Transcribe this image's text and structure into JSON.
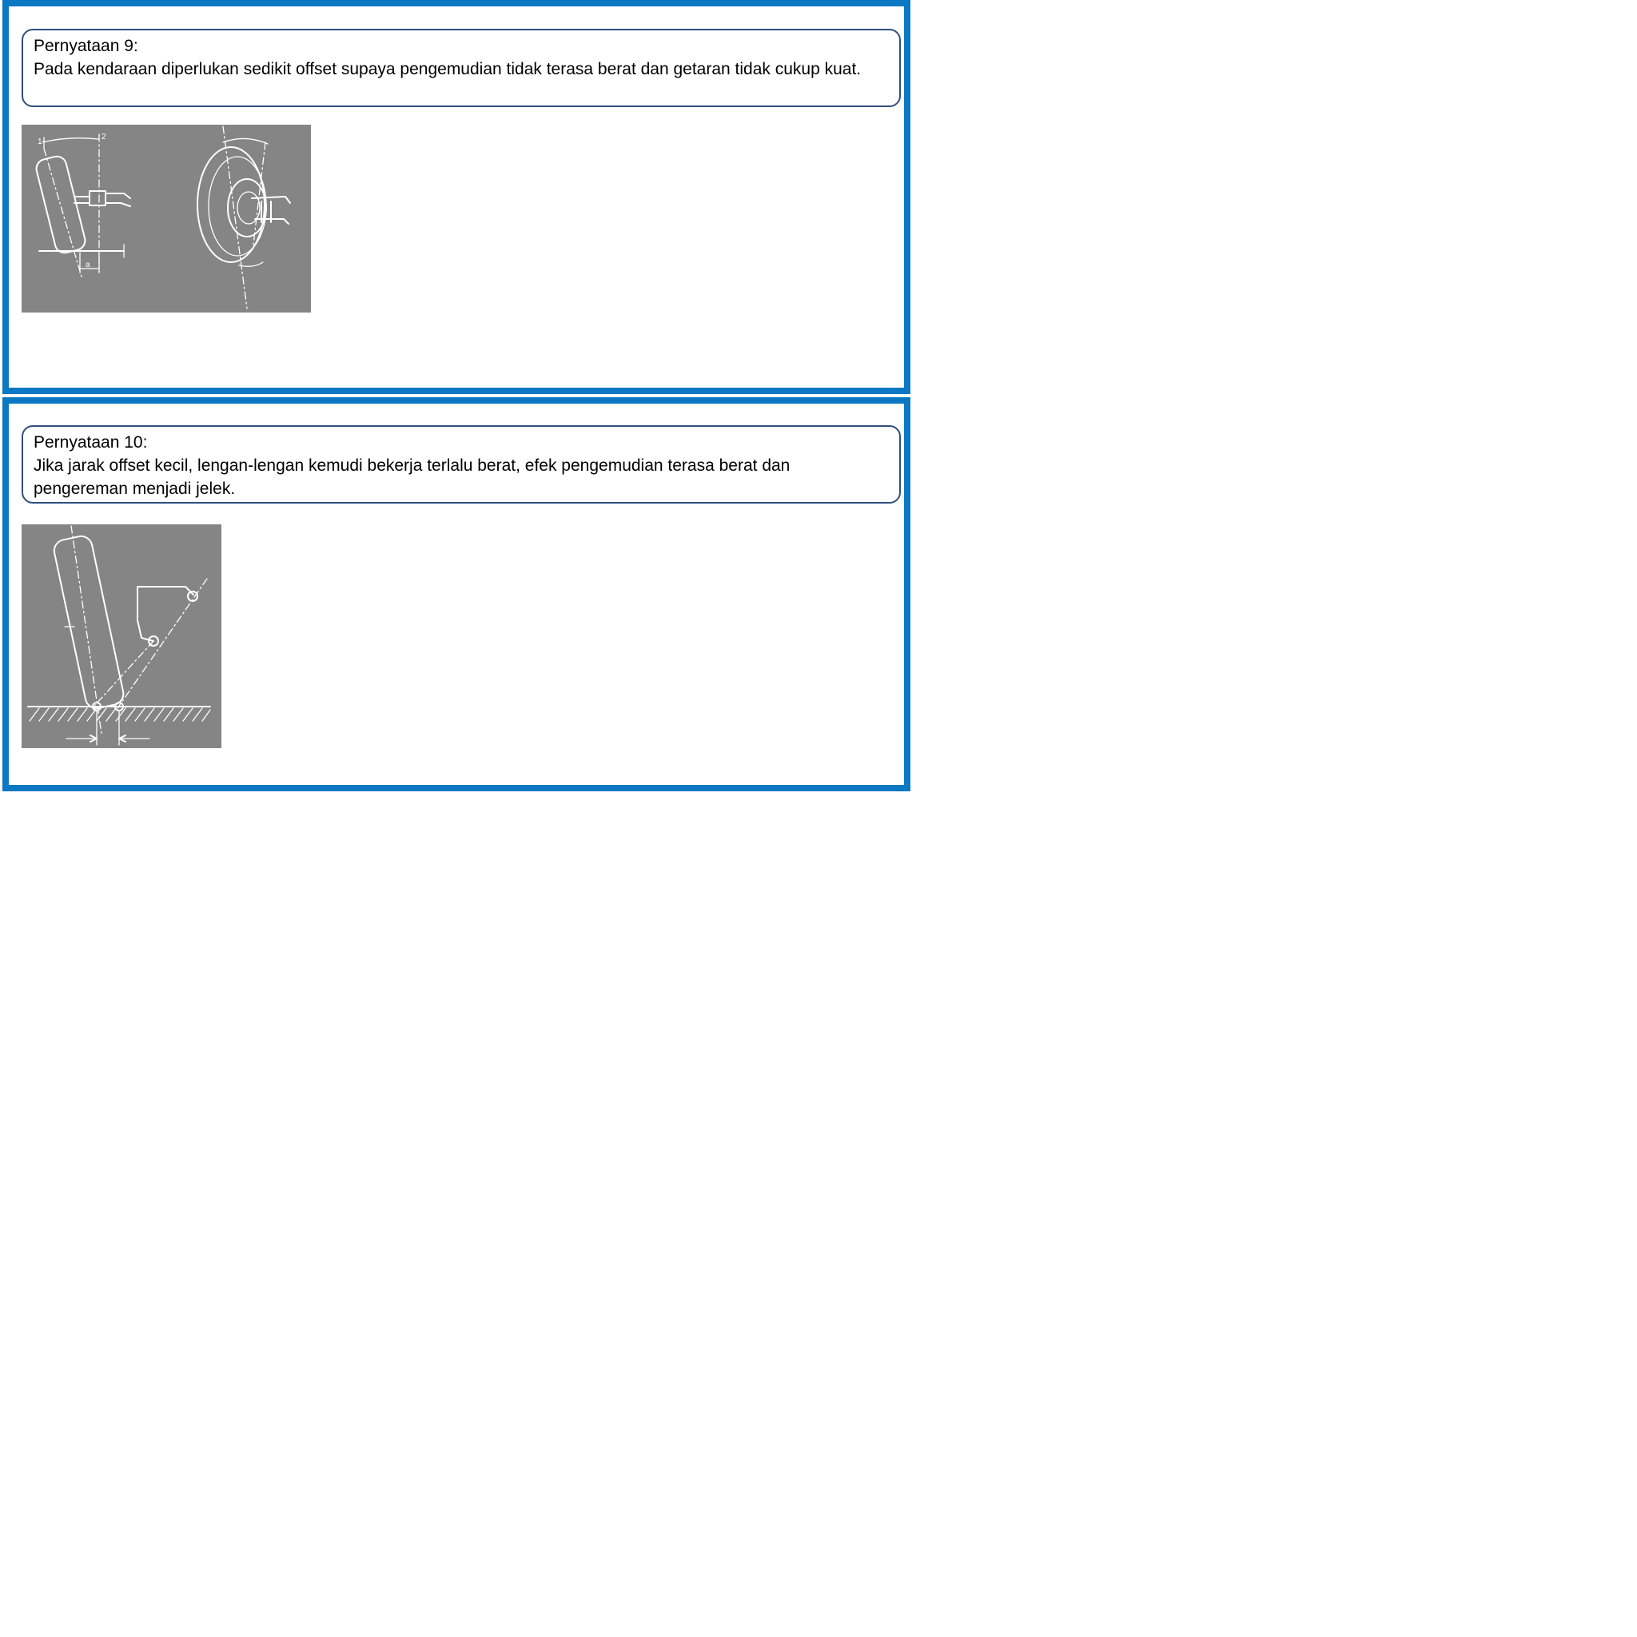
{
  "statements": [
    {
      "title": "Pernyataan 9:",
      "text": "Pada kendaraan diperlukan sedikit offset supaya pengemudian tidak terasa berat dan getaran tidak cukup kuat.",
      "figure_labels": [
        "1",
        "2",
        "a"
      ]
    },
    {
      "title": "Pernyataan 10:",
      "text": "Jika jarak offset kecil, lengan-lengan kemudi bekerja terlalu berat, efek pengemudian terasa berat dan pengereman menjadi jelek."
    }
  ],
  "colors": {
    "panel_border": "#0a78c2",
    "statement_border": "#2f4f7f",
    "figure_background": "#858585",
    "figure_ink": "#ffffff"
  }
}
